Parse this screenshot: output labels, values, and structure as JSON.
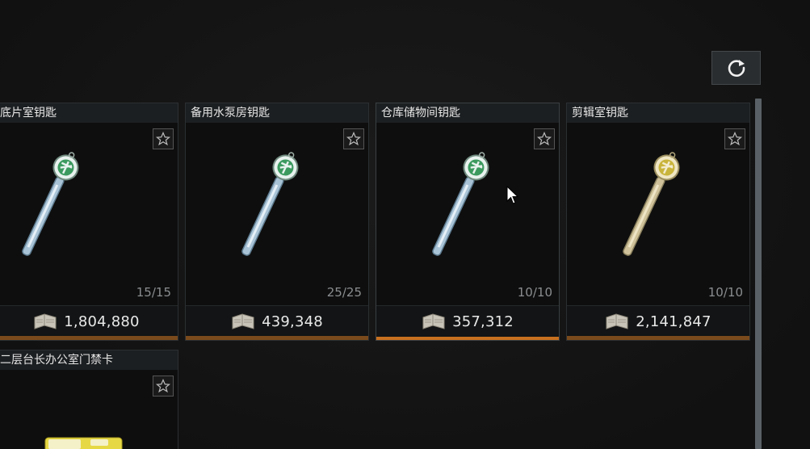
{
  "toolbar": {
    "refresh_icon": "refresh-icon"
  },
  "items": [
    {
      "name": "底片室钥匙",
      "stock": "15/15",
      "price": "1,804,880",
      "color": "silver-green"
    },
    {
      "name": "备用水泵房钥匙",
      "stock": "25/25",
      "price": "439,348",
      "color": "silver-green"
    },
    {
      "name": "仓库储物间钥匙",
      "stock": "10/10",
      "price": "357,312",
      "color": "silver-green",
      "selected": true
    },
    {
      "name": "剪辑室钥匙",
      "stock": "10/10",
      "price": "2,141,847",
      "color": "gold"
    },
    {
      "name": "二层台长办公室门禁卡",
      "color": "yellow-card"
    }
  ],
  "colors": {
    "accent": "#c7701f",
    "panel": "#0e0e0e",
    "border": "#2b2f31"
  }
}
